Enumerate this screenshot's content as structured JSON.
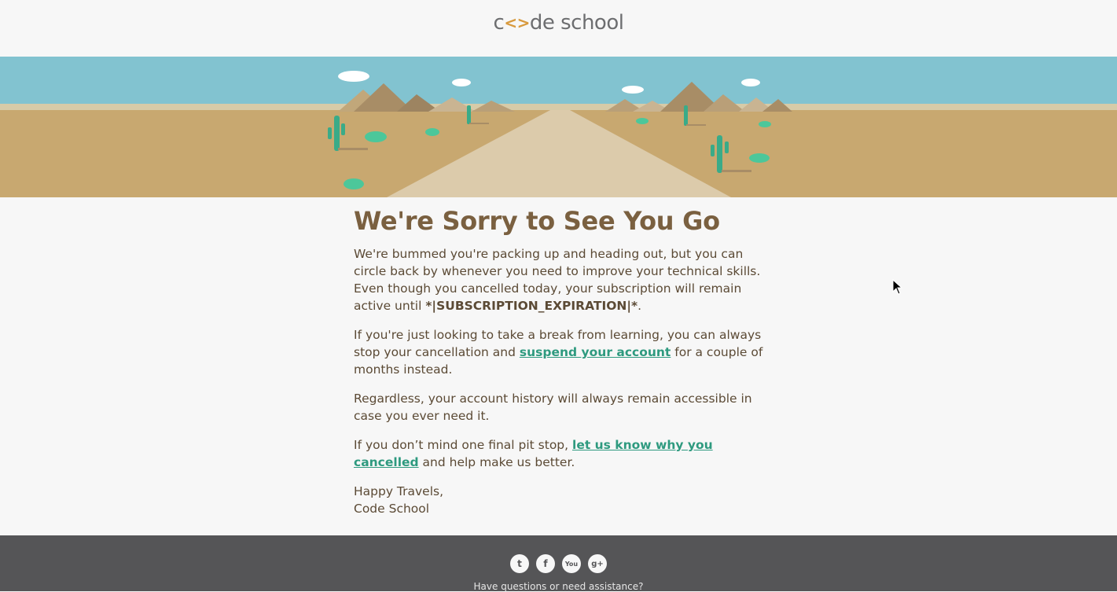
{
  "header": {
    "logo_left": "c",
    "logo_mark": "<>",
    "logo_right": "de school"
  },
  "main": {
    "title": "We're Sorry to See You Go",
    "p1_text": "We're bummed you're packing up and heading out, but you can circle back by whenever you need to improve your technical skills. Even though you cancelled today, your subscription will remain active until ",
    "p1_bold": "*|SUBSCRIPTION_EXPIRATION|*",
    "p1_end": ".",
    "p2_before": "If you're just looking to take a break from learning, you can always stop your cancellation and ",
    "p2_link": "suspend your account",
    "p2_after": " for a couple of months instead.",
    "p3": "Regardless, your account history will always remain accessible in case you ever need it.",
    "p4_before": "If you don’t mind one final pit stop, ",
    "p4_link": "let us know why you cancelled",
    "p4_after": " and help make us better.",
    "signoff_1": "Happy Travels,",
    "signoff_2": "Code School"
  },
  "footer": {
    "social": [
      {
        "icon": "twitter-icon",
        "glyph": "t"
      },
      {
        "icon": "facebook-icon",
        "glyph": "f"
      },
      {
        "icon": "youtube-icon",
        "glyph": "You"
      },
      {
        "icon": "google-plus-icon",
        "glyph": "g+"
      }
    ],
    "help_text": "Have questions or need assistance?"
  },
  "colors": {
    "heading": "#7a6040",
    "body_text": "#5b4a35",
    "link": "#2e9a7f",
    "sky": "#82c3d0",
    "sand": "#c8a870",
    "footer_bg": "#555557"
  }
}
